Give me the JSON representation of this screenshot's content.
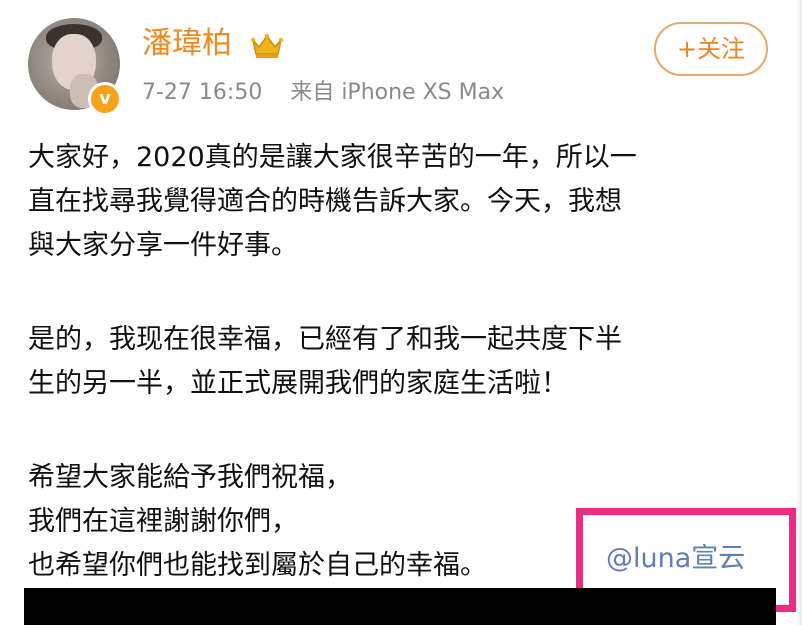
{
  "post": {
    "author": "潘瑋柏",
    "timestamp": "7-27 16:50",
    "source": "来自 iPhone XS Max",
    "follow_label": "+关注",
    "paragraphs": [
      {
        "lines": [
          "大家好，2020真的是讓大家很辛苦的一年，所以一",
          "直在找尋我覺得適合的時機告訴大家。今天，我想",
          "與大家分享一件好事。"
        ]
      },
      {
        "lines": [
          "是的，我现在很幸福，已經有了和我一起共度下半",
          "生的另一半，並正式展開我們的家庭生活啦！"
        ]
      },
      {
        "lines": [
          "希望大家能給予我們祝福，",
          "我們在這裡謝謝你們，",
          "也希望你們也能找到屬於自己的幸福。"
        ]
      }
    ],
    "mention": "@luna宣云"
  },
  "icons": {
    "verified": "verified-badge-icon",
    "crown": "crown-icon"
  },
  "colors": {
    "username": "#f08a1d",
    "follow": "#e8872a",
    "mention": "#5f7fb7",
    "highlight": "#ea2c83",
    "meta": "#8a8a8a"
  }
}
